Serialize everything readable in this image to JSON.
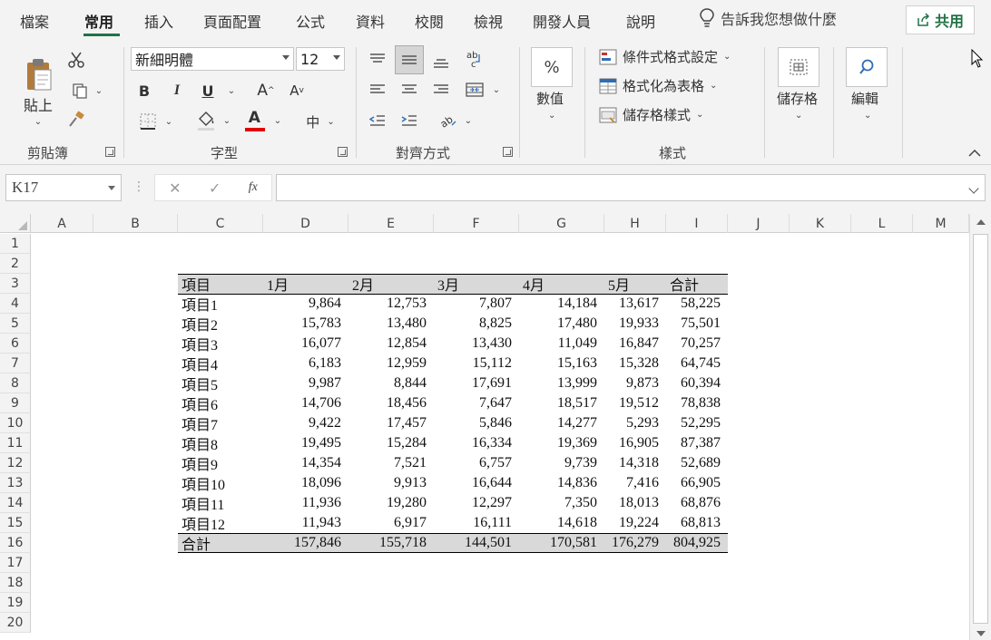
{
  "menu": {
    "tabs": [
      "檔案",
      "常用",
      "插入",
      "頁面配置",
      "公式",
      "資料",
      "校閱",
      "檢視",
      "開發人員",
      "說明"
    ],
    "active": "常用",
    "tell_me": "告訴我您想做什麼",
    "share": "共用"
  },
  "ribbon": {
    "clipboard": {
      "paste": "貼上",
      "label": "剪貼簿"
    },
    "font": {
      "name": "新細明體",
      "size": "12",
      "bold": "B",
      "italic": "I",
      "underline": "U",
      "grow": "A",
      "shrink": "A",
      "color_letter": "A",
      "phonetic": "中",
      "label": "字型",
      "font_color": "#e00000"
    },
    "alignment": {
      "label": "對齊方式"
    },
    "number": {
      "symbol": "%",
      "label": "數值"
    },
    "styles": {
      "conditional": "條件式格式設定",
      "table": "格式化為表格",
      "cell_styles": "儲存格樣式",
      "label": "樣式"
    },
    "cells": {
      "label": "儲存格"
    },
    "editing": {
      "label": "編輯"
    }
  },
  "formula_bar": {
    "name_box": "K17",
    "formula": ""
  },
  "sheet": {
    "columns": [
      "A",
      "B",
      "C",
      "D",
      "E",
      "F",
      "G",
      "H",
      "I",
      "J",
      "K",
      "L",
      "M"
    ],
    "rows": [
      "1",
      "2",
      "3",
      "4",
      "5",
      "6",
      "7",
      "8",
      "9",
      "10",
      "11",
      "12",
      "13",
      "14",
      "15",
      "16",
      "17",
      "18",
      "19",
      "20"
    ],
    "table": {
      "header": [
        "項目",
        "1月",
        "2月",
        "3月",
        "4月",
        "5月",
        "合計"
      ],
      "data": [
        [
          "項目1",
          "9,864",
          "12,753",
          "7,807",
          "14,184",
          "13,617",
          "58,225"
        ],
        [
          "項目2",
          "15,783",
          "13,480",
          "8,825",
          "17,480",
          "19,933",
          "75,501"
        ],
        [
          "項目3",
          "16,077",
          "12,854",
          "13,430",
          "11,049",
          "16,847",
          "70,257"
        ],
        [
          "項目4",
          "6,183",
          "12,959",
          "15,112",
          "15,163",
          "15,328",
          "64,745"
        ],
        [
          "項目5",
          "9,987",
          "8,844",
          "17,691",
          "13,999",
          "9,873",
          "60,394"
        ],
        [
          "項目6",
          "14,706",
          "18,456",
          "7,647",
          "18,517",
          "19,512",
          "78,838"
        ],
        [
          "項目7",
          "9,422",
          "17,457",
          "5,846",
          "14,277",
          "5,293",
          "52,295"
        ],
        [
          "項目8",
          "19,495",
          "15,284",
          "16,334",
          "19,369",
          "16,905",
          "87,387"
        ],
        [
          "項目9",
          "14,354",
          "7,521",
          "6,757",
          "9,739",
          "14,318",
          "52,689"
        ],
        [
          "項目10",
          "18,096",
          "9,913",
          "16,644",
          "14,836",
          "7,416",
          "66,905"
        ],
        [
          "項目11",
          "11,936",
          "19,280",
          "12,297",
          "7,350",
          "18,013",
          "68,876"
        ],
        [
          "項目12",
          "11,943",
          "6,917",
          "16,111",
          "14,618",
          "19,224",
          "68,813"
        ]
      ],
      "total": [
        "合計",
        "157,846",
        "155,718",
        "144,501",
        "170,581",
        "176,279",
        "804,925"
      ]
    }
  },
  "colors": {
    "accent": "#217346",
    "band": "#d9d9d9"
  }
}
